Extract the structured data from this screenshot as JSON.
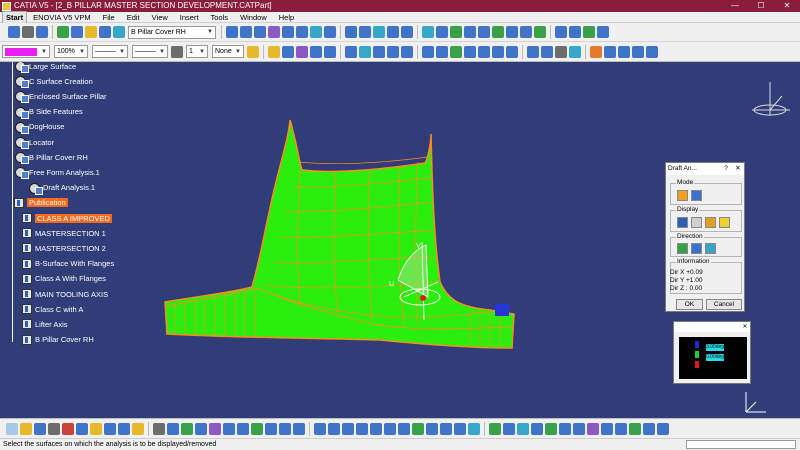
{
  "window": {
    "title": "CATIA V5 - [2_B PILLAR MASTER SECTION DEVELOPMENT.CATPart]",
    "minimize": "—",
    "maximize": "☐",
    "close": "✕"
  },
  "menu": {
    "items": [
      "Start",
      "ENOVIA V5 VPM",
      "File",
      "Edit",
      "View",
      "Insert",
      "Tools",
      "Window",
      "Help"
    ]
  },
  "toolbar": {
    "color_swatch": "#e91ef1",
    "transparency": "100%",
    "linetype": "———",
    "thickness": "———",
    "layer_index": "1",
    "layer_name": "None",
    "current_body": "B Pillar Cover RH"
  },
  "tree": {
    "items": [
      {
        "label": "Large Surface",
        "type": "set"
      },
      {
        "label": "C Surface Creation",
        "type": "set"
      },
      {
        "label": "Enclosed Surface Pillar",
        "type": "set"
      },
      {
        "label": "B Side Features",
        "type": "set"
      },
      {
        "label": "DogHouse",
        "type": "set"
      },
      {
        "label": "Locator",
        "type": "set"
      },
      {
        "label": "B Pillar Cover RH",
        "type": "set"
      },
      {
        "label": "Free Form Analysis.1",
        "type": "set"
      },
      {
        "label": "Draft Analysis.1",
        "type": "sub"
      },
      {
        "label": "Publication",
        "type": "pub",
        "highlight": true
      },
      {
        "label": "CLASS A IMPROVED",
        "type": "pubitem",
        "highlight": true
      },
      {
        "label": "MASTERSECTION 1",
        "type": "pubitem"
      },
      {
        "label": "MASTERSECTION 2",
        "type": "pubitem"
      },
      {
        "label": "B-Surface With Flanges",
        "type": "pubitem"
      },
      {
        "label": "Class A With Flanges",
        "type": "pubitem"
      },
      {
        "label": "MAIN TOOLING AXIS",
        "type": "pubitem"
      },
      {
        "label": "Class C with A",
        "type": "pubitem"
      },
      {
        "label": "Lifter Axis",
        "type": "pubitem"
      },
      {
        "label": "B Pillar Cover RH",
        "type": "pubitem"
      }
    ]
  },
  "draft_panel": {
    "title": "Draft An...",
    "help": "?",
    "close": "✕",
    "mode_label": "Mode",
    "display_label": "Display",
    "direction_label": "Direction",
    "information_label": "Information",
    "dir_x": "Dir X +0.09",
    "dir_y": "Dir Y +1.00",
    "dir_z": "Dir Z :  0.00",
    "ok_label": "OK",
    "cancel_label": "Cancel"
  },
  "color_panel": {
    "labels": [
      "3.00deg",
      "0.00deg"
    ],
    "colors": [
      "#1d2ad6",
      "#1fd12c",
      "#e01a1a"
    ]
  },
  "viewport": {
    "background": "#313d78",
    "surface_color": "#2bee0e",
    "edge_color": "#ff8c1a",
    "label_u": "U",
    "label_v": "V"
  },
  "status": {
    "text": "Select the surfaces on which the analysis is to be displayed/removed"
  }
}
